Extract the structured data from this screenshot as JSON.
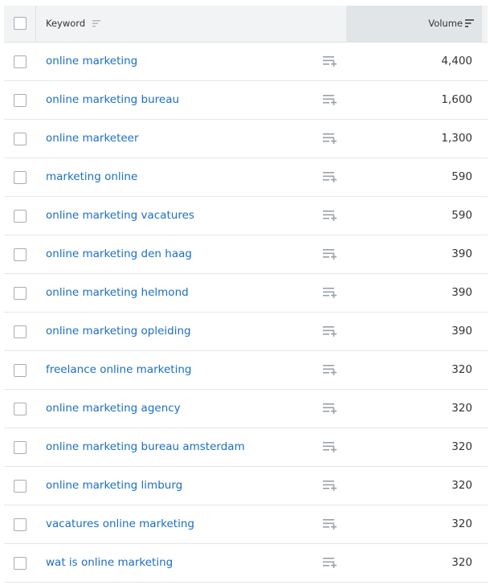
{
  "header": {
    "select_all_checked": false,
    "keyword_label": "Keyword",
    "keyword_sort_icon": "sort-icon",
    "volume_label": "Volume",
    "volume_sort_icon": "sort-descending-icon"
  },
  "colors": {
    "link": "#1b6ec2",
    "header_bg": "#f2f3f4",
    "active_column_bg": "#e2e5e7",
    "icon_gray": "#9aa1a6",
    "text": "#333333"
  },
  "row_icon": "add-to-list-icon",
  "rows": [
    {
      "keyword": "online marketing",
      "volume": "4,400"
    },
    {
      "keyword": "online marketing bureau",
      "volume": "1,600"
    },
    {
      "keyword": "online marketeer",
      "volume": "1,300"
    },
    {
      "keyword": "marketing online",
      "volume": "590"
    },
    {
      "keyword": "online marketing vacatures",
      "volume": "590"
    },
    {
      "keyword": "online marketing den haag",
      "volume": "390"
    },
    {
      "keyword": "online marketing helmond",
      "volume": "390"
    },
    {
      "keyword": "online marketing opleiding",
      "volume": "390"
    },
    {
      "keyword": "freelance online marketing",
      "volume": "320"
    },
    {
      "keyword": "online marketing agency",
      "volume": "320"
    },
    {
      "keyword": "online marketing bureau amsterdam",
      "volume": "320"
    },
    {
      "keyword": "online marketing limburg",
      "volume": "320"
    },
    {
      "keyword": "vacatures online marketing",
      "volume": "320"
    },
    {
      "keyword": "wat is online marketing",
      "volume": "320"
    }
  ]
}
